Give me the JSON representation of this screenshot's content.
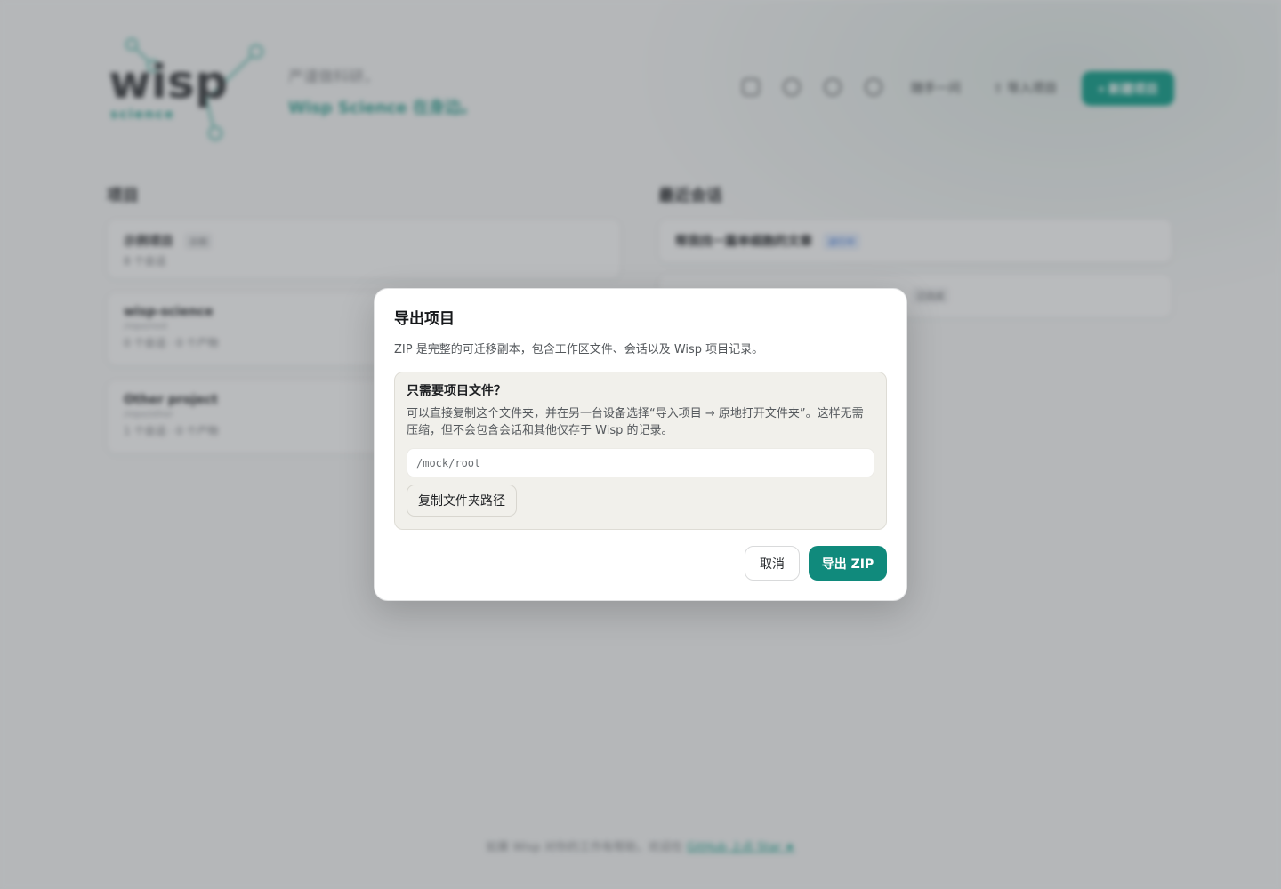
{
  "background": {
    "logo": {
      "word": "wisp",
      "sub": "science"
    },
    "tagline": {
      "line1": "严谨做科研，",
      "line2": "Wisp Science 在身边。"
    },
    "header": {
      "link1": "随手一问",
      "link2": "导入项目",
      "new_project": "+ 新建项目"
    },
    "projects": {
      "title": "项目",
      "items": [
        {
          "name": "示例项目",
          "badge": "示例",
          "path": "",
          "meta": "8 个会话"
        },
        {
          "name": "wisp-science",
          "badge": "",
          "path": "/repo/root",
          "meta": "0 个会话 · 0 个产物"
        },
        {
          "name": "Other project",
          "badge": "",
          "path": "/repo/other",
          "meta": "1 个会话 · 0 个产物"
        }
      ]
    },
    "sessions": {
      "title": "最近会话",
      "items": [
        {
          "name": "帮我找一篇单细胞的文章",
          "badge": "进行中"
        },
        {
          "name": "",
          "badge": "已完成"
        }
      ]
    },
    "footer": {
      "text": "如果 Wisp 对你的工作有帮助，欢迎在",
      "link": "GitHub 上点 Star ★"
    }
  },
  "dialog": {
    "title": "导出项目",
    "description": "ZIP 是完整的可迁移副本，包含工作区文件、会话以及 Wisp 项目记录。",
    "hint": {
      "title": "只需要项目文件？",
      "body": "可以直接复制这个文件夹，并在另一台设备选择“导入项目 → 原地打开文件夹”。这样无需压缩，但不会包含会话和其他仅存于 Wisp 的记录。",
      "path_value": "/mock/root",
      "copy_button": "复制文件夹路径"
    },
    "actions": {
      "cancel": "取消",
      "export": "导出 ZIP"
    }
  },
  "colors": {
    "accent": "#108a7c",
    "accent_light": "#14a08c",
    "hint_bg": "#f1f0eb"
  }
}
